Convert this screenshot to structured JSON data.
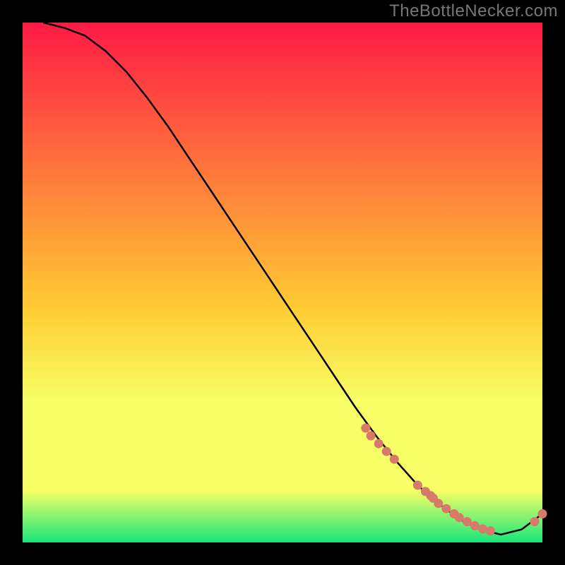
{
  "watermark": "TheBottleNecker.com",
  "colors": {
    "bg": "#000000",
    "line": "#000000",
    "marker": "#d87a6a",
    "gradient_top": "#ff1a44",
    "gradient_mid": "#ffcc33",
    "gradient_band": "#f8ff66",
    "gradient_bottom": "#17e67a"
  },
  "chart_data": {
    "type": "line",
    "title": "",
    "xlabel": "",
    "ylabel": "",
    "xlim": [
      0,
      100
    ],
    "ylim": [
      0,
      100
    ],
    "grid": false,
    "legend": false,
    "series": [
      {
        "name": "curve",
        "x": [
          4,
          8,
          12,
          16,
          20,
          24,
          28,
          32,
          36,
          40,
          44,
          48,
          52,
          56,
          60,
          64,
          68,
          72,
          76,
          80,
          84,
          88,
          92,
          96,
          100
        ],
        "y": [
          100,
          99,
          97.5,
          94.5,
          90.5,
          85.5,
          80,
          74,
          68,
          62,
          56,
          50,
          44,
          38,
          32,
          26,
          20.5,
          15.5,
          11,
          7.5,
          4.5,
          2.5,
          1.5,
          2.5,
          5.5
        ]
      }
    ],
    "markers": {
      "name": "dots",
      "x": [
        66,
        67,
        68.5,
        70,
        71.5,
        76,
        77.5,
        78.5,
        79,
        80,
        81.5,
        83,
        84,
        85.5,
        87,
        88.5,
        90,
        98.5,
        100
      ],
      "y": [
        22,
        20.5,
        19,
        17.5,
        16,
        11,
        9.8,
        9,
        8.5,
        7.5,
        6.5,
        5.5,
        4.8,
        4,
        3.2,
        2.6,
        2.2,
        4,
        5.5
      ]
    }
  }
}
